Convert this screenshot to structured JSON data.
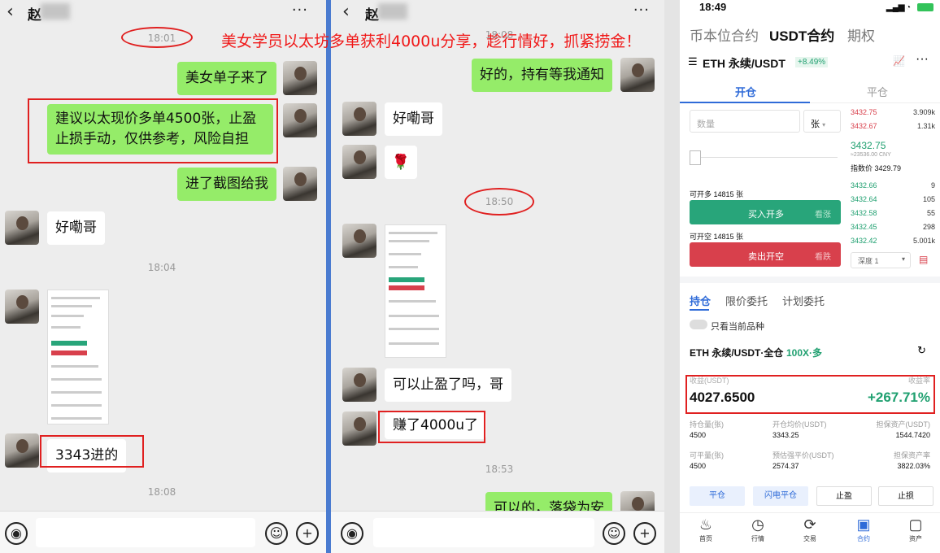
{
  "overlay_title": "美女学员以太坊多单获利4000u分享，趁行情好，抓紧捞金！",
  "chat1": {
    "back_icon": "‹",
    "name": "赵",
    "more_icon": "···",
    "times": [
      "18:01",
      "18:04",
      "18:08"
    ],
    "messages": {
      "m1": "美女单子来了",
      "m2_line1": "建议以太现价多单4500张，止盈",
      "m2_line2": "止损手动，仅供参考，风险自担",
      "m3": "进了截图给我",
      "m4": "好嘞哥",
      "m5": "3343进的"
    }
  },
  "chat2": {
    "back_icon": "‹",
    "name": "赵",
    "more_icon": "···",
    "times": [
      "18:08",
      "18:50",
      "18:53"
    ],
    "messages": {
      "m1": "好的，持有等我通知",
      "m2": "好嘞哥",
      "m3": "🌹",
      "m4": "可以止盈了吗，哥",
      "m5": "赚了4000u了",
      "m6": "可以的，落袋为安"
    }
  },
  "trade": {
    "status_time": "18:49",
    "tabs": [
      "币本位合约",
      "USDT合约",
      "期权"
    ],
    "pair": "ETH 永续/USDT",
    "change": "+8.49%",
    "open_tab": "开仓",
    "close_tab": "平仓",
    "qty_placeholder": "数量",
    "unit": "张",
    "asks": [
      {
        "price": "3432.75",
        "size": "3.909k"
      },
      {
        "price": "3432.67",
        "size": "1.31k"
      }
    ],
    "last_price": "3432.75",
    "cny": "≈23536.00 CNY",
    "index_label": "指数价 3429.79",
    "bids": [
      {
        "price": "3432.66",
        "size": "9"
      },
      {
        "price": "3432.64",
        "size": "105"
      },
      {
        "price": "3432.58",
        "size": "55"
      },
      {
        "price": "3432.45",
        "size": "298"
      },
      {
        "price": "3432.42",
        "size": "5.001k"
      }
    ],
    "can_long": "可开多 14815 张",
    "buy_label": "买入开多",
    "buy_hint": "看涨",
    "can_short": "可开空 14815 张",
    "sell_label": "卖出开空",
    "sell_hint": "看跌",
    "depth_label": "深度 1",
    "section_tabs": [
      "持仓",
      "限价委托",
      "计划委托"
    ],
    "only_current": "只看当前品种",
    "position_title": "ETH 永续/USDT·全仓",
    "leverage": "100X·多",
    "pnl_label": "收益(USDT)",
    "roe_label": "收益率",
    "pnl": "4027.6500",
    "roe": "+267.71%",
    "stats": [
      {
        "label": "持仓量(张)",
        "value": "4500"
      },
      {
        "label": "开仓均价(USDT)",
        "value": "3343.25"
      },
      {
        "label": "担保资产(USDT)",
        "value": "1544.7420"
      },
      {
        "label": "可平量(张)",
        "value": "4500"
      },
      {
        "label": "预估强平价(USDT)",
        "value": "2574.37"
      },
      {
        "label": "担保资产率",
        "value": "3822.03%"
      }
    ],
    "actions": [
      "平仓",
      "闪电平仓",
      "止盈",
      "止损"
    ],
    "nav": [
      "首页",
      "行情",
      "交易",
      "合约",
      "资产"
    ]
  },
  "colors": {
    "green_bubble": "#95ec69",
    "red_mark": "#e02020",
    "buy": "#28a57a",
    "sell": "#d8404c",
    "blue": "#2f6bd8"
  }
}
